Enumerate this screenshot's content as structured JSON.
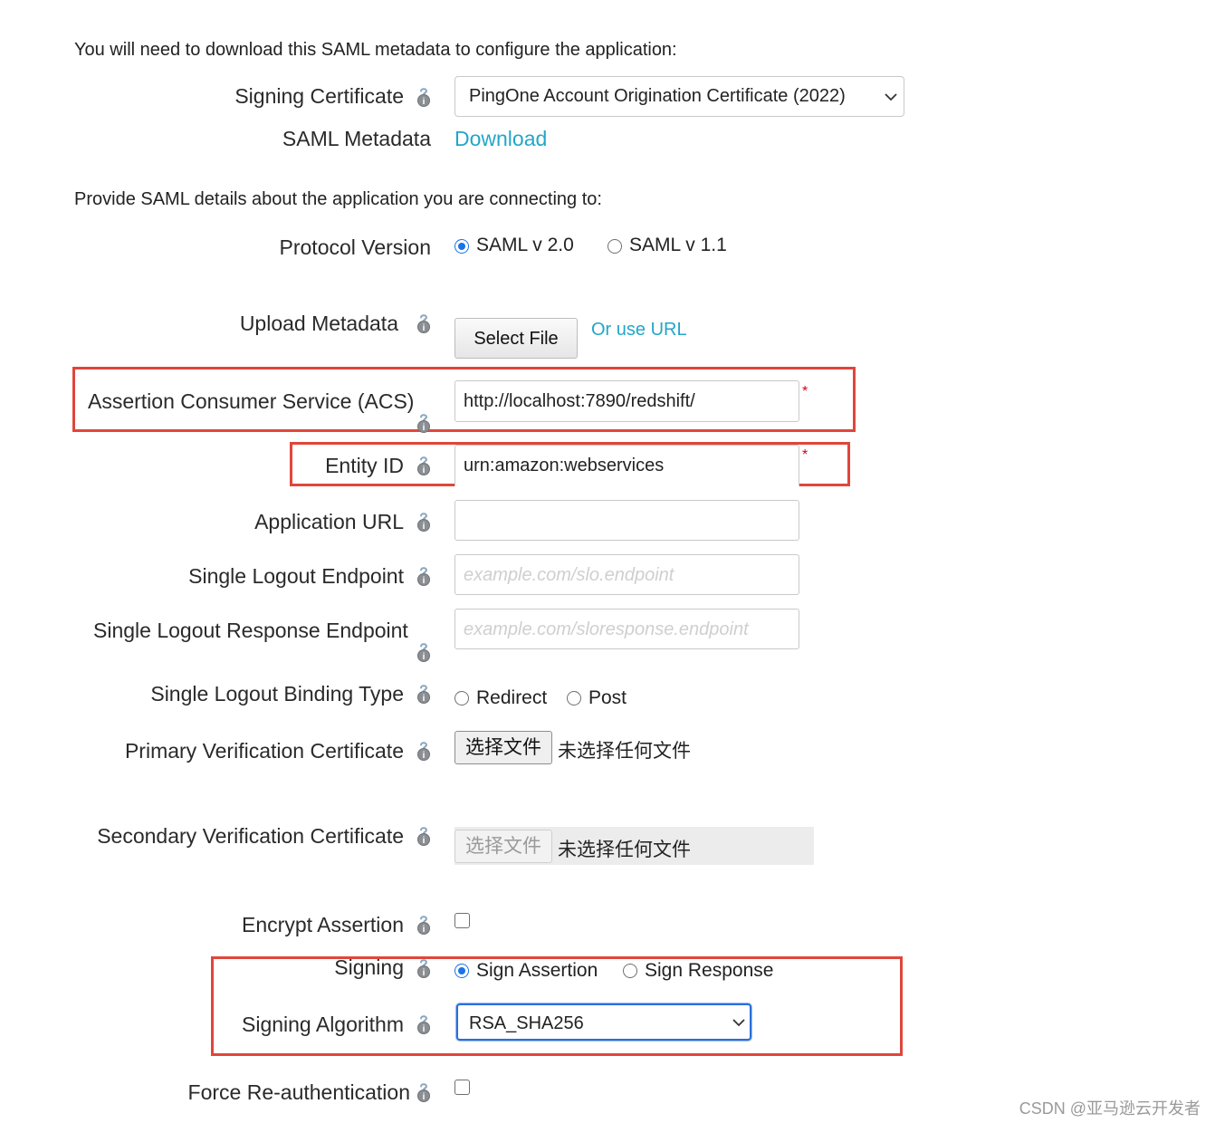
{
  "intro_download": "You will need to download this SAML metadata to configure the application:",
  "signing_certificate": {
    "label": "Signing Certificate",
    "selected": "PingOne Account Origination Certificate (2022)"
  },
  "saml_metadata": {
    "label": "SAML Metadata",
    "link": "Download"
  },
  "intro_provide": "Provide SAML details about the application you are connecting to:",
  "protocol_version": {
    "label": "Protocol Version",
    "options": [
      "SAML v 2.0",
      "SAML v 1.1"
    ],
    "selected": "SAML v 2.0"
  },
  "upload_metadata": {
    "label": "Upload Metadata",
    "button": "Select File",
    "link": "Or use URL"
  },
  "acs": {
    "label": "Assertion Consumer Service (ACS)",
    "value": "http://localhost:7890/redshift/",
    "required_mark": "*"
  },
  "entity_id": {
    "label": "Entity ID",
    "value": "urn:amazon:webservices",
    "required_mark": "*"
  },
  "application_url": {
    "label": "Application URL",
    "value": ""
  },
  "single_logout_endpoint": {
    "label": "Single Logout Endpoint",
    "placeholder": "example.com/slo.endpoint"
  },
  "single_logout_response_endpoint": {
    "label": "Single Logout Response Endpoint",
    "placeholder": "example.com/sloresponse.endpoint"
  },
  "single_logout_binding_type": {
    "label": "Single Logout Binding Type",
    "options": [
      "Redirect",
      "Post"
    ]
  },
  "primary_verification_certificate": {
    "label": "Primary Verification Certificate",
    "button": "选择文件",
    "status": "未选择任何文件"
  },
  "secondary_verification_certificate": {
    "label": "Secondary Verification Certificate",
    "button": "选择文件",
    "status": "未选择任何文件"
  },
  "encrypt_assertion": {
    "label": "Encrypt Assertion",
    "checked": false
  },
  "signing": {
    "label": "Signing",
    "options": [
      "Sign Assertion",
      "Sign Response"
    ],
    "selected": "Sign Assertion"
  },
  "signing_algorithm": {
    "label": "Signing Algorithm",
    "selected": "RSA_SHA256"
  },
  "force_reauthentication": {
    "label": "Force Re-authentication",
    "checked": false
  },
  "watermark": "CSDN @亚马逊云开发者",
  "colors": {
    "link": "#22a6c9",
    "highlight_box": "#e0463a",
    "radio_selected": "#1a73e8",
    "required": "#d0021b"
  },
  "icons": {
    "help": "help-icon",
    "dropdown": "chevron-down-icon"
  }
}
